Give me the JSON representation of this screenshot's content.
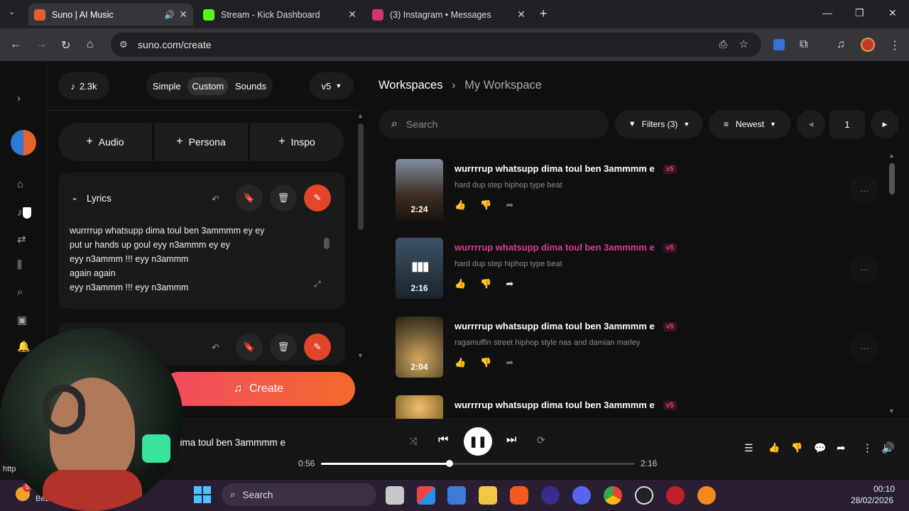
{
  "browser": {
    "tabs": [
      {
        "title": "Suno | AI Music",
        "favicon_color": "#e85d2c"
      },
      {
        "title": "Stream - Kick Dashboard",
        "favicon_color": "#53fc18"
      },
      {
        "title": "(3) Instagram • Messages",
        "favicon_color": "#d6336c"
      }
    ],
    "url": "suno.com/create"
  },
  "create": {
    "credits": "2.3k",
    "modes": [
      "Simple",
      "Custom",
      "Sounds"
    ],
    "active_mode": "Custom",
    "model": "v5",
    "add_buttons": [
      "Audio",
      "Persona",
      "Inspo"
    ],
    "lyrics_label": "Lyrics",
    "lyrics": [
      "wurrrrup whatsupp dima toul ben 3ammmm ey ey",
      "put ur hands up goul eyy n3ammm ey ey",
      "eyy n3ammm  !!! eyy n3ammm",
      "again again",
      "eyy n3ammm  !!! eyy n3ammm"
    ],
    "create_label": "Create"
  },
  "workspace": {
    "breadcrumb_root": "Workspaces",
    "breadcrumb_current": "My Workspace",
    "search_placeholder": "Search",
    "filters_label": "Filters (3)",
    "sort_label": "Newest",
    "page": "1",
    "songs": [
      {
        "title": "wurrrrup whatsupp dima toul ben 3ammmm e",
        "version": "v5",
        "style": "hard dup step hiphop type beat",
        "duration": "2:24",
        "playing": false,
        "thumb": "#4a5a6e"
      },
      {
        "title": "wurrrrup whatsupp dima toul ben 3ammmm e",
        "version": "v5",
        "style": "hard dup step hiphop type beat",
        "duration": "2:16",
        "playing": true,
        "thumb": "#3c5266"
      },
      {
        "title": "wurrrrup whatsupp dima toul ben 3ammmm e",
        "version": "v5",
        "style": "ragamuffin street hiphop style nas and damian marley",
        "duration": "2:04",
        "playing": false,
        "thumb": "#6e5a34"
      },
      {
        "title": "wurrrrup whatsupp dima toul ben 3ammmm e",
        "version": "v5",
        "style": "",
        "duration": "",
        "playing": false,
        "thumb": "#8a6a2a"
      }
    ]
  },
  "player": {
    "track_title": "dima toul ben 3ammmm e",
    "elapsed": "0:56",
    "total": "2:16",
    "progress_fraction": 0.41
  },
  "taskbar": {
    "search_label": "Search",
    "time": "00:10",
    "date": "28/02/2026",
    "weather_badge": "5",
    "weather_label": "Bezn",
    "status_url": "http"
  },
  "colors": {
    "accent": "#e2452a",
    "playing_title": "#e23d8a",
    "badge": "#e23d8a"
  }
}
